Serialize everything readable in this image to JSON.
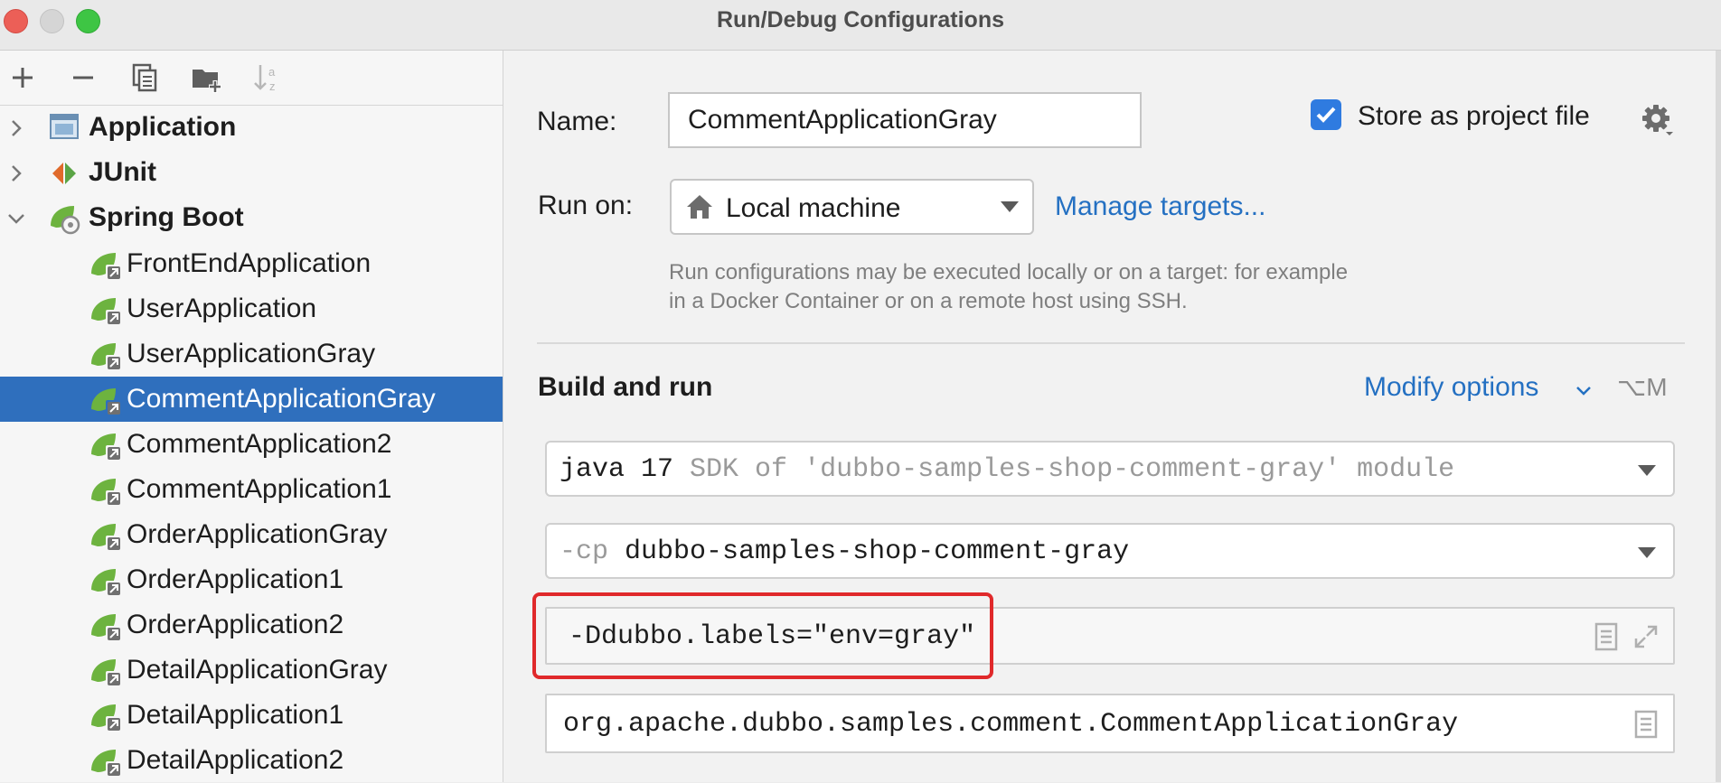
{
  "window": {
    "title": "Run/Debug Configurations"
  },
  "tree": {
    "groups": [
      {
        "label": "Application",
        "expanded": false,
        "icon": "application-icon"
      },
      {
        "label": "JUnit",
        "expanded": false,
        "icon": "junit-icon"
      },
      {
        "label": "Spring Boot",
        "expanded": true,
        "icon": "spring-boot-icon"
      }
    ],
    "items": [
      {
        "label": "FrontEndApplication",
        "selected": false
      },
      {
        "label": "UserApplication",
        "selected": false
      },
      {
        "label": "UserApplicationGray",
        "selected": false
      },
      {
        "label": "CommentApplicationGray",
        "selected": true
      },
      {
        "label": "CommentApplication2",
        "selected": false
      },
      {
        "label": "CommentApplication1",
        "selected": false
      },
      {
        "label": "OrderApplicationGray",
        "selected": false
      },
      {
        "label": "OrderApplication1",
        "selected": false
      },
      {
        "label": "OrderApplication2",
        "selected": false
      },
      {
        "label": "DetailApplicationGray",
        "selected": false
      },
      {
        "label": "DetailApplication1",
        "selected": false
      },
      {
        "label": "DetailApplication2",
        "selected": false
      }
    ]
  },
  "toolbar": {
    "icons": [
      "plus-icon",
      "minus-icon",
      "copy-icon",
      "folder-add-icon",
      "sort-az-icon"
    ]
  },
  "form": {
    "name_label": "Name:",
    "name_value": "CommentApplicationGray",
    "store_label": "Store as project file",
    "store_checked": true,
    "runon_label": "Run on:",
    "runon_value": "Local machine",
    "manage_targets": "Manage targets...",
    "hint_line1": "Run configurations may be executed locally or on a target: for example",
    "hint_line2": "in a Docker Container or on a remote host using SSH.",
    "build_run_title": "Build and run",
    "modify_options": "Modify options",
    "modify_shortcut": "⌥M",
    "jre_main": "java 17",
    "jre_hint": "SDK of 'dubbo-samples-shop-comment-gray' module",
    "cp_prefix": "-cp",
    "cp_value": "dubbo-samples-shop-comment-gray",
    "vm_options": "-Ddubbo.labels=\"env=gray\"",
    "main_class": "org.apache.dubbo.samples.comment.CommentApplicationGray"
  },
  "colors": {
    "accent": "#2470c2",
    "selection": "#2f6fbd",
    "highlight": "#e0292b",
    "checkbox": "#2f7be0"
  }
}
